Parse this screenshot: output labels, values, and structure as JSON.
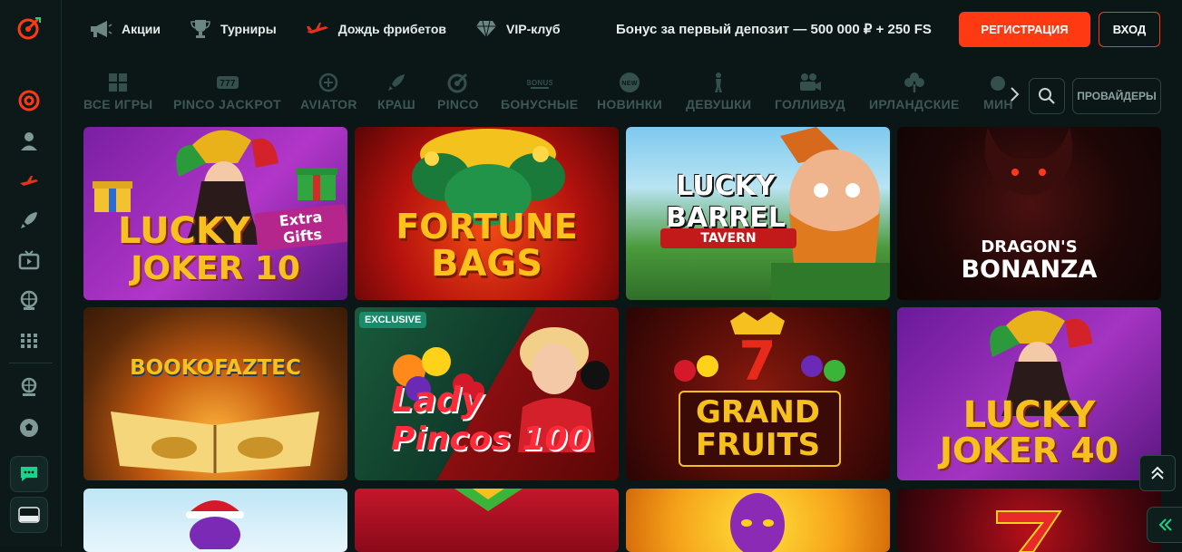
{
  "colors": {
    "accent": "#ff3a12",
    "background": "#0b1716",
    "muted": "#3d5754",
    "badge": "#1a8a6a"
  },
  "header": {
    "nav": [
      {
        "label": "Акции",
        "icon": "megaphone-icon"
      },
      {
        "label": "Турниры",
        "icon": "trophy-icon"
      },
      {
        "label": "Дождь фрибетов",
        "icon": "plane-icon"
      },
      {
        "label": "VIP-клуб",
        "icon": "diamond-icon"
      }
    ],
    "bonus_text": "Бонус за первый депозит — 500 000 ₽ + 250 FS",
    "register_label": "РЕГИСТРАЦИЯ",
    "login_label": "ВХОД"
  },
  "categories": [
    {
      "label": "ВСЕ ИГРЫ",
      "icon": "grid-icon"
    },
    {
      "label": "PINCO JACKPOT",
      "icon": "jackpot-icon"
    },
    {
      "label": "AVIATOR",
      "icon": "aviator-icon"
    },
    {
      "label": "КРАШ",
      "icon": "rocket-icon"
    },
    {
      "label": "PINCO",
      "icon": "pinco-icon"
    },
    {
      "label": "БОНУСНЫЕ",
      "icon": "bonus-icon",
      "icon_text": "BONUS"
    },
    {
      "label": "НОВИНКИ",
      "icon": "new-icon",
      "icon_text": "NEW"
    },
    {
      "label": "ДЕВУШКИ",
      "icon": "girl-icon"
    },
    {
      "label": "ГОЛЛИВУД",
      "icon": "camera-icon"
    },
    {
      "label": "ИРЛАНДСКИЕ",
      "icon": "clover-icon"
    },
    {
      "label": "МИН",
      "icon": "mine-icon"
    }
  ],
  "providers_label": "ПРОВАЙДЕРЫ",
  "games": [
    {
      "title_line1": "LUCKY",
      "title_line2": "JOKER 10",
      "extra": "Extra Gifts"
    },
    {
      "title_line1": "FORTUNE",
      "title_line2": "BAGS"
    },
    {
      "title_line1": "LUCKY BARREL",
      "title_line2": "TAVERN"
    },
    {
      "title_line1": "DRAGON'S",
      "title_line2": "BONANZA"
    },
    {
      "title_line1": "BOOKOFAZTEC",
      "title_line2": ""
    },
    {
      "title_line1": "Lady",
      "title_line2": "Pincos 100",
      "badge": "EXCLUSIVE"
    },
    {
      "title_line1": "GRAND",
      "title_line2": "FRUITS"
    },
    {
      "title_line1": "LUCKY",
      "title_line2": "JOKER 40"
    },
    {
      "title_line1": "",
      "title_line2": ""
    },
    {
      "title_line1": "",
      "title_line2": ""
    },
    {
      "title_line1": "",
      "title_line2": ""
    },
    {
      "title_line1": "",
      "title_line2": ""
    }
  ]
}
